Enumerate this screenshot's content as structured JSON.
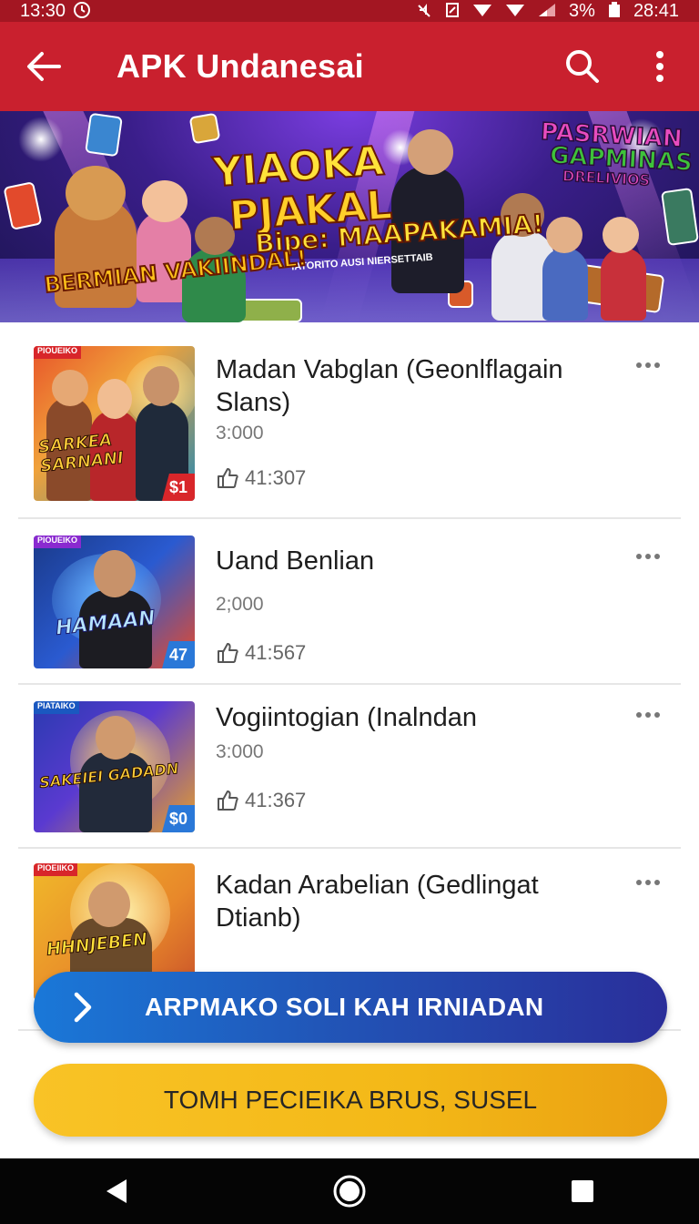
{
  "status_bar": {
    "left_time": "13:30",
    "battery": "3%",
    "right_time": "28:41"
  },
  "app_bar": {
    "title": "APK Undanesai"
  },
  "banner": {
    "headline_line1": "YIAOKA",
    "headline_line2": "PJAKAL",
    "headline_line3": "Bipe: MAAPAKAMIA!",
    "small_text": "IATORITO AUSI NIERSETTAIB",
    "left_badge": "BERMIAN VAKIINDAL!",
    "right_badge_line1": "PASRWIAN",
    "right_badge_line2": "GAPMINAS",
    "right_badge_line3": "DRELIVIOS"
  },
  "games": [
    {
      "tag": "PIOUEIKO",
      "thumb_text": "SARKEA SARNANI",
      "price": "$1",
      "title": "Madan Vabglan (Geonlflagain Slans)",
      "sub": "3:000",
      "stat": "41:307"
    },
    {
      "tag": "PIOUEIKO",
      "thumb_text": "HAMAAN",
      "price": "47",
      "title": "Uand Benlian",
      "sub": "2;000",
      "stat": "41:567"
    },
    {
      "tag": "PIATAIKO",
      "thumb_text": "SAKEIEI GADADN",
      "price": "$0",
      "title": "Vogiintogian (Inalndan",
      "sub": "3:000",
      "stat": "41:367"
    },
    {
      "tag": "PIOEIIKO",
      "thumb_text": "HHNJEBEN",
      "title": "Kadan Arabelian (Gedlingat Dtianb)"
    }
  ],
  "buttons": {
    "primary": "ARPMAKO SOLI KAH IRNIADAN",
    "secondary": "TOMH PECIEIKA BRUS, SUSEL"
  },
  "colors": {
    "app_bar": "#c9202e",
    "status_bar": "#a31622",
    "primary_button": "#2156b8",
    "secondary_button": "#f3b817"
  }
}
